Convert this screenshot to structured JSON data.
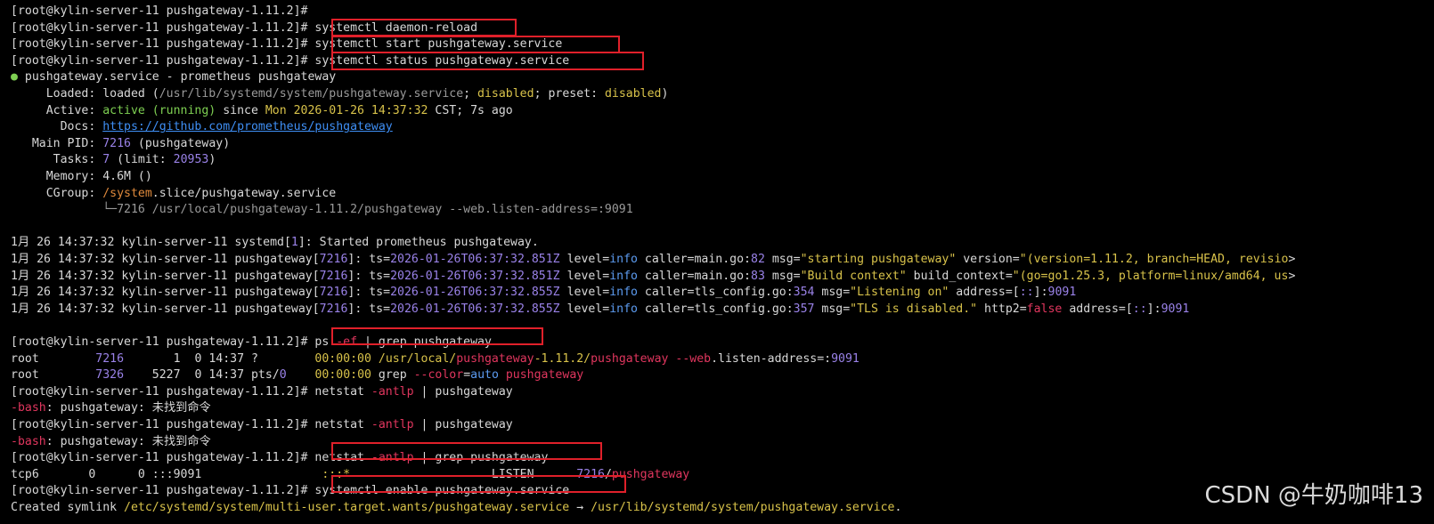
{
  "colors": {
    "background": "#000000",
    "text": "#d8d8d8",
    "green": "#7ecf52",
    "red": "#e0365e",
    "purple": "#9a82e8",
    "yellow": "#d8c24a",
    "highlight_box": "#e0202a"
  },
  "terminal": {
    "lines": [
      {
        "segs": [
          {
            "t": "[root@kylin-server-11 pushgateway-1.11.2]#"
          }
        ]
      },
      {
        "segs": [
          {
            "t": "[root@kylin-server-11 pushgateway-1.11.2]# systemctl daemon-reload"
          }
        ]
      },
      {
        "segs": [
          {
            "t": "[root@kylin-server-11 pushgateway-1.11.2]# systemctl start pushgateway.service"
          }
        ]
      },
      {
        "segs": [
          {
            "t": "[root@kylin-server-11 pushgateway-1.11.2]# systemctl status pushgateway.service"
          }
        ]
      },
      {
        "segs": [
          {
            "t": "●",
            "c": "green"
          },
          {
            "t": " pushgateway.service - prometheus pushgateway"
          }
        ]
      },
      {
        "segs": [
          {
            "t": "     Loaded: loaded ("
          },
          {
            "t": "/usr/lib/systemd/system/pushgateway.service",
            "c": "gray"
          },
          {
            "t": "; "
          },
          {
            "t": "disabled",
            "c": "yellow"
          },
          {
            "t": "; preset: "
          },
          {
            "t": "disabled",
            "c": "yellow"
          },
          {
            "t": ")"
          }
        ]
      },
      {
        "segs": [
          {
            "t": "     Active: "
          },
          {
            "t": "active (running)",
            "c": "green"
          },
          {
            "t": " since "
          },
          {
            "t": "Mon 2026-01-26 14:37:32",
            "c": "yellow"
          },
          {
            "t": " CST; 7s ago"
          }
        ]
      },
      {
        "segs": [
          {
            "t": "       Docs: "
          },
          {
            "t": "https://github.com/prometheus/pushgateway",
            "c": "link"
          }
        ]
      },
      {
        "segs": [
          {
            "t": "   Main PID: "
          },
          {
            "t": "7216",
            "c": "purple"
          },
          {
            "t": " (pushgateway)"
          }
        ]
      },
      {
        "segs": [
          {
            "t": "      Tasks: "
          },
          {
            "t": "7",
            "c": "purple"
          },
          {
            "t": " (limit: "
          },
          {
            "t": "20953",
            "c": "purple"
          },
          {
            "t": ")"
          }
        ]
      },
      {
        "segs": [
          {
            "t": "     Memory: 4.6M ()"
          }
        ]
      },
      {
        "segs": [
          {
            "t": "     CGroup: "
          },
          {
            "t": "/system",
            "c": "orange"
          },
          {
            "t": ".slice/pushgateway.service"
          }
        ]
      },
      {
        "segs": [
          {
            "t": "             └─7216 /usr/local/pushgateway-1.11.2/pushgateway --web.listen-address=:9091",
            "c": "gray"
          }
        ]
      },
      {
        "segs": [
          {
            "t": ""
          }
        ]
      },
      {
        "segs": [
          {
            "t": "1月 26 14:37:32 kylin-server-11 systemd["
          },
          {
            "t": "1",
            "c": "purple"
          },
          {
            "t": "]: Started prometheus pushgateway."
          }
        ]
      },
      {
        "segs": [
          {
            "t": "1月 26 14:37:32 kylin-server-11 pushgateway["
          },
          {
            "t": "7216",
            "c": "purple"
          },
          {
            "t": "]: ts="
          },
          {
            "t": "2026-01-26T06:37:32.851Z",
            "c": "purple"
          },
          {
            "t": " level="
          },
          {
            "t": "info",
            "c": "blue"
          },
          {
            "t": " caller=main.go:"
          },
          {
            "t": "82",
            "c": "purple"
          },
          {
            "t": " msg="
          },
          {
            "t": "\"starting pushgateway\"",
            "c": "yellow"
          },
          {
            "t": " version="
          },
          {
            "t": "\"(version=1.11.2, branch=HEAD, revisio",
            "c": "yellow"
          },
          {
            "t": ">"
          }
        ]
      },
      {
        "segs": [
          {
            "t": "1月 26 14:37:32 kylin-server-11 pushgateway["
          },
          {
            "t": "7216",
            "c": "purple"
          },
          {
            "t": "]: ts="
          },
          {
            "t": "2026-01-26T06:37:32.851Z",
            "c": "purple"
          },
          {
            "t": " level="
          },
          {
            "t": "info",
            "c": "blue"
          },
          {
            "t": " caller=main.go:"
          },
          {
            "t": "83",
            "c": "purple"
          },
          {
            "t": " msg="
          },
          {
            "t": "\"Build context\"",
            "c": "yellow"
          },
          {
            "t": " build_context="
          },
          {
            "t": "\"(go=go1.25.3, platform=linux/amd64, us",
            "c": "yellow"
          },
          {
            "t": ">"
          }
        ]
      },
      {
        "segs": [
          {
            "t": "1月 26 14:37:32 kylin-server-11 pushgateway["
          },
          {
            "t": "7216",
            "c": "purple"
          },
          {
            "t": "]: ts="
          },
          {
            "t": "2026-01-26T06:37:32.855Z",
            "c": "purple"
          },
          {
            "t": " level="
          },
          {
            "t": "info",
            "c": "blue"
          },
          {
            "t": " caller=tls_config.go:"
          },
          {
            "t": "354",
            "c": "purple"
          },
          {
            "t": " msg="
          },
          {
            "t": "\"Listening on\"",
            "c": "yellow"
          },
          {
            "t": " address=["
          },
          {
            "t": "::",
            "c": "purple"
          },
          {
            "t": "]:"
          },
          {
            "t": "9091",
            "c": "purple"
          }
        ]
      },
      {
        "segs": [
          {
            "t": "1月 26 14:37:32 kylin-server-11 pushgateway["
          },
          {
            "t": "7216",
            "c": "purple"
          },
          {
            "t": "]: ts="
          },
          {
            "t": "2026-01-26T06:37:32.855Z",
            "c": "purple"
          },
          {
            "t": " level="
          },
          {
            "t": "info",
            "c": "blue"
          },
          {
            "t": " caller=tls_config.go:"
          },
          {
            "t": "357",
            "c": "purple"
          },
          {
            "t": " msg="
          },
          {
            "t": "\"TLS is disabled.\"",
            "c": "yellow"
          },
          {
            "t": " http2="
          },
          {
            "t": "false",
            "c": "red"
          },
          {
            "t": " address=["
          },
          {
            "t": "::",
            "c": "purple"
          },
          {
            "t": "]:"
          },
          {
            "t": "9091",
            "c": "purple"
          }
        ]
      },
      {
        "segs": [
          {
            "t": ""
          }
        ]
      },
      {
        "segs": [
          {
            "t": "[root@kylin-server-11 pushgateway-1.11.2]# ps "
          },
          {
            "t": "-ef",
            "c": "red"
          },
          {
            "t": " | grep pushgateway"
          }
        ]
      },
      {
        "segs": [
          {
            "t": "root        "
          },
          {
            "t": "7216",
            "c": "purple"
          },
          {
            "t": "       1  0 14:37 ?        "
          },
          {
            "t": "00:00:00",
            "c": "yellow"
          },
          {
            "t": " /usr/local/",
            "c": "yellow"
          },
          {
            "t": "pushgateway",
            "c": "red"
          },
          {
            "t": "-1.11.2/",
            "c": "yellow"
          },
          {
            "t": "pushgateway",
            "c": "red"
          },
          {
            "t": " "
          },
          {
            "t": "--web",
            "c": "red"
          },
          {
            "t": ".listen-address=:"
          },
          {
            "t": "9091",
            "c": "purple"
          }
        ]
      },
      {
        "segs": [
          {
            "t": "root        "
          },
          {
            "t": "7326",
            "c": "purple"
          },
          {
            "t": "    5227  0 14:37 pts/"
          },
          {
            "t": "0",
            "c": "purple"
          },
          {
            "t": "    "
          },
          {
            "t": "00:00:00",
            "c": "yellow"
          },
          {
            "t": " grep "
          },
          {
            "t": "--color",
            "c": "red"
          },
          {
            "t": "="
          },
          {
            "t": "auto",
            "c": "blue"
          },
          {
            "t": " "
          },
          {
            "t": "pushgateway",
            "c": "red"
          }
        ]
      },
      {
        "segs": [
          {
            "t": "[root@kylin-server-11 pushgateway-1.11.2]# netstat "
          },
          {
            "t": "-antlp",
            "c": "red"
          },
          {
            "t": " | pushgateway"
          }
        ]
      },
      {
        "segs": [
          {
            "t": "-bash",
            "c": "red"
          },
          {
            "t": ": pushgateway: 未找到命令"
          }
        ]
      },
      {
        "segs": [
          {
            "t": "[root@kylin-server-11 pushgateway-1.11.2]# netstat "
          },
          {
            "t": "-antlp",
            "c": "red"
          },
          {
            "t": " | pushgateway"
          }
        ]
      },
      {
        "segs": [
          {
            "t": "-bash",
            "c": "red"
          },
          {
            "t": ": pushgateway: 未找到命令"
          }
        ]
      },
      {
        "segs": [
          {
            "t": "[root@kylin-server-11 pushgateway-1.11.2]# netstat "
          },
          {
            "t": "-antlp",
            "c": "red"
          },
          {
            "t": " | grep pushgateway"
          }
        ]
      },
      {
        "segs": [
          {
            "t": "tcp6       0      0 :::9091                 "
          },
          {
            "t": ":::*",
            "c": "yellow"
          },
          {
            "t": "                    LISTEN      "
          },
          {
            "t": "7216",
            "c": "purple"
          },
          {
            "t": "/"
          },
          {
            "t": "pushgateway",
            "c": "red"
          }
        ]
      },
      {
        "segs": [
          {
            "t": "[root@kylin-server-11 pushgateway-1.11.2]# systemctl enable pushgateway.service"
          }
        ]
      },
      {
        "segs": [
          {
            "t": "Created symlink "
          },
          {
            "t": "/etc/systemd/system/multi-user.target.wants/pushgateway.service",
            "c": "yellow"
          },
          {
            "t": " → "
          },
          {
            "t": "/usr/lib/systemd/system/pushgateway.service",
            "c": "yellow"
          },
          {
            "t": "."
          }
        ]
      }
    ]
  },
  "watermark": "CSDN @牛奶咖啡13"
}
